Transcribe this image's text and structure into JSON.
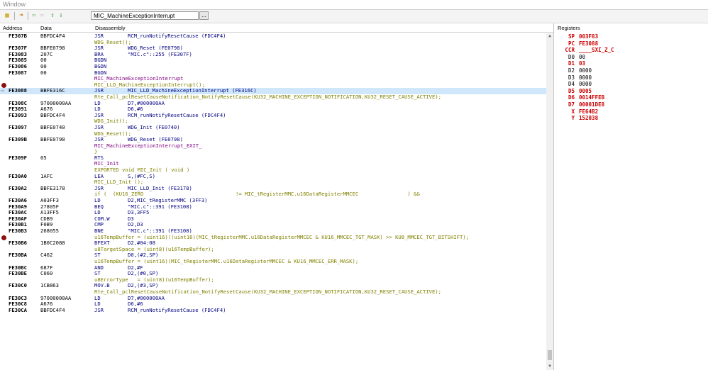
{
  "window": {
    "title": "Window"
  },
  "toolbar": {
    "function_name": "MIC_MachineExceptionInterrupt",
    "browse_label": "..."
  },
  "columns": {
    "address": "Address",
    "data": "Data",
    "disassembly": "Disassembly",
    "registers": "Registers"
  },
  "colors": {
    "mnemonic": "#000080",
    "source": "#808000",
    "label": "#800080",
    "register_changed": "#cc0000",
    "highlight": "#cfe6fb",
    "breakpoint": "#8b1010"
  },
  "rows": [
    {
      "addr": "FE307B",
      "data": "BBFDC4F4",
      "mn": "JSR",
      "op": "RCM_runNotifyResetCause (FDC4F4)"
    },
    {
      "src": "WDG_Reset();"
    },
    {
      "addr": "FE307F",
      "data": "BBFE0798",
      "mn": "JSR",
      "op": "WDG_Reset (FE0798)"
    },
    {
      "addr": "FE3083",
      "data": "207C",
      "mn": "BRA",
      "op": "\"MIC.c\"::255 (FE307F)"
    },
    {
      "addr": "FE3085",
      "data": "00",
      "mn": "BGDN",
      "op": ""
    },
    {
      "addr": "FE3086",
      "data": "00",
      "mn": "BGDN",
      "op": ""
    },
    {
      "addr": "FE3087",
      "data": "00",
      "mn": "BGDN",
      "op": ""
    },
    {
      "lbl": "MIC_MachineExceptionInterrupt"
    },
    {
      "src": "MIC_LLD_MachineExceptionInterrupt();",
      "bp": true
    },
    {
      "addr": "FE3088",
      "data": "BBFE316C",
      "mn": "JSR",
      "op": "MIC_LLD_MachineExceptionInterrupt (FE316C)",
      "hl": true,
      "pc": true
    },
    {
      "src": "Rte_Call_pclResetCauseNotification_NotifyResetCause(KU32_MACHINE_EXCEPTION_NOTIFICATION,KU32_RESET_CAUSE_ACTIVE);"
    },
    {
      "addr": "FE308C",
      "data": "97000000AA",
      "mn": "LD",
      "op": "D7,#000000AA"
    },
    {
      "addr": "FE3091",
      "data": "A676",
      "mn": "LD",
      "op": "D6,#6"
    },
    {
      "addr": "FE3093",
      "data": "BBFDC4F4",
      "mn": "JSR",
      "op": "RCM_runNotifyResetCause (FDC4F4)"
    },
    {
      "src": "WDG_Init();"
    },
    {
      "addr": "FE3097",
      "data": "BBFE0740",
      "mn": "JSR",
      "op": "WDG_Init (FE0740)"
    },
    {
      "src": "WDG_Reset();"
    },
    {
      "addr": "FE309B",
      "data": "BBFE0798",
      "mn": "JSR",
      "op": "WDG_Reset (FE0798)"
    },
    {
      "lbl": "MIC_MachineExceptionInterrupt_EXIT_"
    },
    {
      "src": "}"
    },
    {
      "addr": "FE309F",
      "data": "05",
      "mn": "RTS",
      "op": ""
    },
    {
      "lbl": "MIC_Init"
    },
    {
      "src": "EXPORTED void MIC_Init ( void )"
    },
    {
      "addr": "FE30A0",
      "data": "1AFC",
      "mn": "LEA",
      "op": "S,(#FC,S)"
    },
    {
      "src": "MIC_LLD_Init ();"
    },
    {
      "addr": "FE30A2",
      "data": "BBFE3178",
      "mn": "JSR",
      "op": "MIC_LLD_Init (FE3178)"
    },
    {
      "src": "if (  (KU16_ZERO                              != MIC_tRegisterMMC.u16DataRegisterMMCEC                ) &&"
    },
    {
      "addr": "FE30A6",
      "data": "A03FF3",
      "mn": "LD",
      "op": "D2,MIC_tRegisterMMC (3FF3)"
    },
    {
      "addr": "FE30A9",
      "data": "27805F",
      "mn": "BEQ",
      "op": "\"MIC.c\"::391 (FE3108)"
    },
    {
      "addr": "FE30AC",
      "data": "A13FF5",
      "mn": "LD",
      "op": "D3,3FF5"
    },
    {
      "addr": "FE30AF",
      "data": "CDB9",
      "mn": "COM.W",
      "op": "D3"
    },
    {
      "addr": "FE30B1",
      "data": "F0B9",
      "mn": "CMP",
      "op": "D2,D3"
    },
    {
      "addr": "FE30B3",
      "data": "268055",
      "mn": "BNE",
      "op": "\"MIC.c\"::391 (FE3108)"
    },
    {
      "src": "u16TempBuffer = (uint16)((uint16)(MIC_tRegisterMMC.u16DataRegisterMMCEC & KU16_MMCEC_TGT_MASK) >> KU8_MMCEC_TGT_BITSHIFT);",
      "bp": true
    },
    {
      "addr": "FE30B6",
      "data": "1B0C2088",
      "mn": "BFEXT",
      "op": "D2,#04:08"
    },
    {
      "src": "u8TargetSpace = (uint8)(u16TempBuffer);"
    },
    {
      "addr": "FE30BA",
      "data": "C462",
      "mn": "ST",
      "op": "D0,(#2,SP)"
    },
    {
      "src": "u16TempBuffer = (uint16)(MIC_tRegisterMMC.u16DataRegisterMMCEC & KU16_MMCEC_ERR_MASK);"
    },
    {
      "addr": "FE30BC",
      "data": "687F",
      "mn": "AND",
      "op": "D2,#F"
    },
    {
      "addr": "FE30BE",
      "data": "C060",
      "mn": "ST",
      "op": "D2,(#0,SP)"
    },
    {
      "src": "u8ErrorType   = (uint8)(u16TempBuffer);"
    },
    {
      "addr": "FE30C0",
      "data": "1CB863",
      "mn": "MOV.B",
      "op": "D2,(#3,SP)"
    },
    {
      "src": "Rte_Call_pclResetCauseNotification_NotifyResetCause(KU32_MACHINE_EXCEPTION_NOTIFICATION,KU32_RESET_CAUSE_ACTIVE);"
    },
    {
      "addr": "FE30C3",
      "data": "97000000AA",
      "mn": "LD",
      "op": "D7,#000000AA"
    },
    {
      "addr": "FE30C8",
      "data": "A676",
      "mn": "LD",
      "op": "D6,#6"
    },
    {
      "addr": "FE30CA",
      "data": "BBFDC4F4",
      "mn": "JSR",
      "op": "RCM_runNotifyResetCause (FDC4F4)"
    }
  ],
  "registers": [
    {
      "name": "SP",
      "value": "003F83",
      "changed": true
    },
    {
      "name": "PC",
      "value": "FE3088",
      "changed": true
    },
    {
      "name": "CCR",
      "value": "____SXI_Z_C",
      "changed": true
    },
    {
      "name": "D0",
      "value": "00",
      "changed": false
    },
    {
      "name": "D1",
      "value": "03",
      "changed": true
    },
    {
      "name": "D2",
      "value": "0000",
      "changed": false
    },
    {
      "name": "D3",
      "value": "0000",
      "changed": false
    },
    {
      "name": "D4",
      "value": "0000",
      "changed": false
    },
    {
      "name": "D5",
      "value": "0005",
      "changed": true
    },
    {
      "name": "D6",
      "value": "0014FFEB",
      "changed": true
    },
    {
      "name": "D7",
      "value": "00001DE8",
      "changed": true
    },
    {
      "name": "X",
      "value": "FE64B2",
      "changed": true
    },
    {
      "name": "Y",
      "value": "152038",
      "changed": true
    }
  ]
}
